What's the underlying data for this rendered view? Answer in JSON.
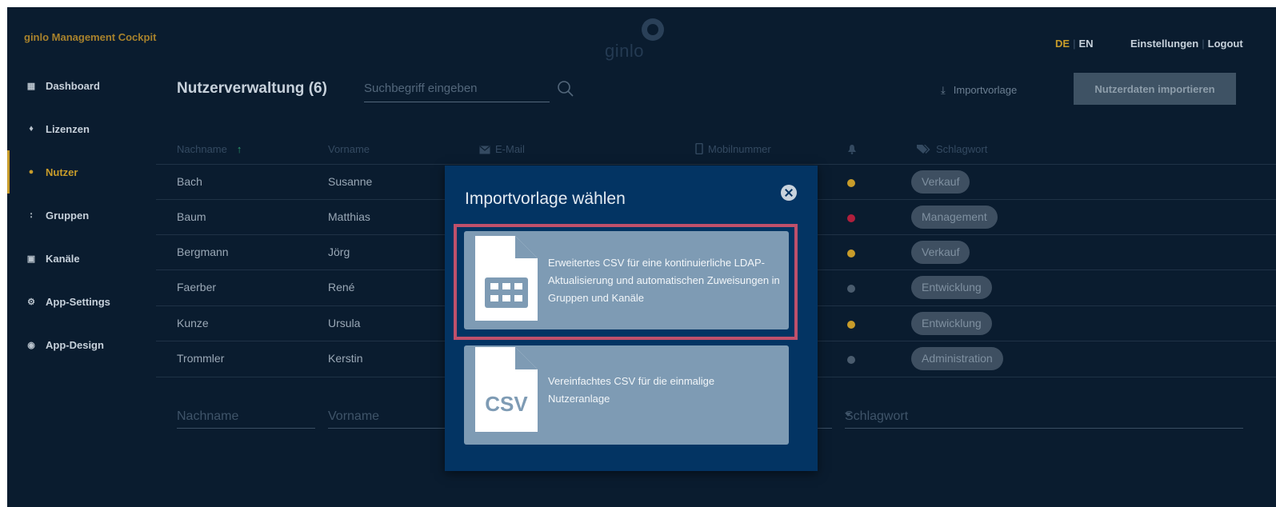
{
  "app": {
    "brand": "ginlo Management Cockpit",
    "logo_text": "ginlo"
  },
  "header": {
    "lang_de": "DE",
    "lang_sep": "|",
    "lang_en": "EN",
    "settings": "Einstellungen",
    "link_sep": "|",
    "logout": "Logout"
  },
  "sidebar": {
    "items": [
      {
        "label": "Dashboard",
        "icon": "dashboard-icon"
      },
      {
        "label": "Lizenzen",
        "icon": "licenses-icon"
      },
      {
        "label": "Nutzer",
        "icon": "user-icon"
      },
      {
        "label": "Gruppen",
        "icon": "groups-icon"
      },
      {
        "label": "Kanäle",
        "icon": "channels-icon"
      },
      {
        "label": "App-Settings",
        "icon": "gear-icon"
      },
      {
        "label": "App-Design",
        "icon": "palette-icon"
      }
    ],
    "active_index": 2
  },
  "main": {
    "title": "Nutzerverwaltung (6)",
    "search": {
      "placeholder": "Suchbegriff eingeben"
    },
    "import_template": "Importvorlage",
    "import_button": "Nutzerdaten importieren"
  },
  "table": {
    "columns": {
      "lastname": "Nachname",
      "firstname": "Vorname",
      "email": "E-Mail",
      "mobile": "Mobilnummer",
      "keyword": "Schlagwort"
    },
    "rows": [
      {
        "lastname": "Bach",
        "firstname": "Susanne",
        "tag": "Verkauf",
        "status_color": "#c89c2a"
      },
      {
        "lastname": "Baum",
        "firstname": "Matthias",
        "tag": "Management",
        "status_color": "#b01f3c"
      },
      {
        "lastname": "Bergmann",
        "firstname": "Jörg",
        "tag": "Verkauf",
        "status_color": "#c89c2a"
      },
      {
        "lastname": "Faerber",
        "firstname": "René",
        "tag": "Entwicklung",
        "status_color": "#4a5c6e"
      },
      {
        "lastname": "Kunze",
        "firstname": "Ursula",
        "tag": "Entwicklung",
        "status_color": "#c89c2a"
      },
      {
        "lastname": "Trommler",
        "firstname": "Kerstin",
        "tag": "Administration",
        "status_color": "#4a5c6e"
      }
    ]
  },
  "filters": {
    "lastname": "Nachname",
    "firstname": "Vorname",
    "keyword": "Schlagwort"
  },
  "modal": {
    "title": "Importvorlage wählen",
    "options": [
      {
        "icon": "spreadsheet-file-icon",
        "description": "Erweitertes CSV für eine kontinuierliche LDAP-Aktualisierung und automatischen Zuweisungen in Gruppen und Kanäle"
      },
      {
        "icon": "csv-file-icon",
        "badge": "CSV",
        "description": "Vereinfachtes CSV für die einmalige Nutzeranlage"
      }
    ]
  },
  "colors": {
    "background": "#0a1c2f",
    "accent": "#c89c2a",
    "modal": "#033463",
    "option_card": "#7e9bb4",
    "highlight": "#c0506b",
    "sort_arrow": "#2c9d6e"
  }
}
